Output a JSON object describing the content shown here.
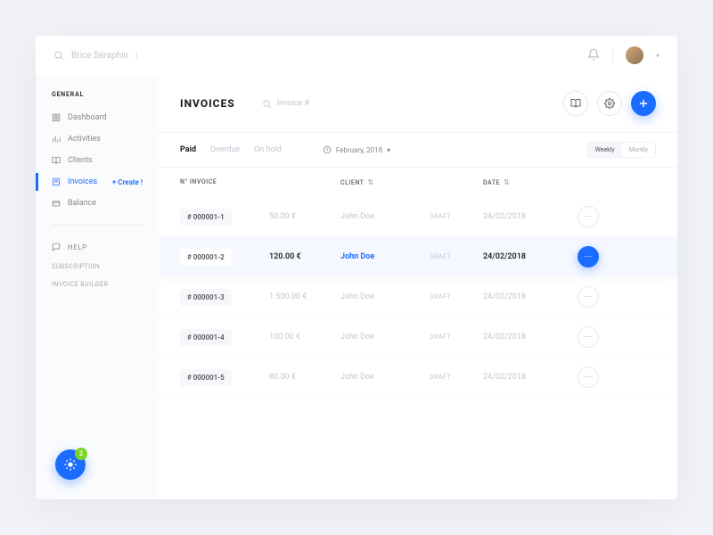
{
  "search": {
    "placeholder": "Brice Séraphin"
  },
  "sidebar": {
    "section": "GENERAL",
    "items": [
      {
        "label": "Dashboard"
      },
      {
        "label": "Activities"
      },
      {
        "label": "Clients"
      },
      {
        "label": "Invoices",
        "create": "+ Create !"
      },
      {
        "label": "Balance"
      }
    ],
    "help": "HELP",
    "subscription": "SUBSCRIPTION",
    "builder": "INVOICE BUILDER"
  },
  "fab": {
    "badge": "2"
  },
  "header": {
    "title": "INVOICES",
    "search_placeholder": "Invoice #"
  },
  "tabs": {
    "paid": "Paid",
    "overdue": "Overdue",
    "onhold": "On hold"
  },
  "date_filter": "February, 2018",
  "freq": {
    "weekly": "Weekly",
    "monthly": "Montly"
  },
  "thead": {
    "invoice": "N° INVOICE",
    "client": "CLIENT",
    "date": "DATE"
  },
  "rows": [
    {
      "num": "# 000001-1",
      "amount": "50.00 €",
      "client": "John Doe",
      "status": "DRAFT",
      "date": "24/02/2018"
    },
    {
      "num": "# 000001-2",
      "amount": "120.00 €",
      "client": "John Doe",
      "status": "DRAFT",
      "date": "24/02/2018"
    },
    {
      "num": "# 000001-3",
      "amount": "1 500.00 €",
      "client": "John Doe",
      "status": "DRAFT",
      "date": "24/02/2018"
    },
    {
      "num": "# 000001-4",
      "amount": "100.00 €",
      "client": "John Doe",
      "status": "DRAFT",
      "date": "24/02/2018"
    },
    {
      "num": "# 000001-5",
      "amount": "80.00 €",
      "client": "John Doe",
      "status": "DRAFT",
      "date": "24/02/2018"
    }
  ]
}
